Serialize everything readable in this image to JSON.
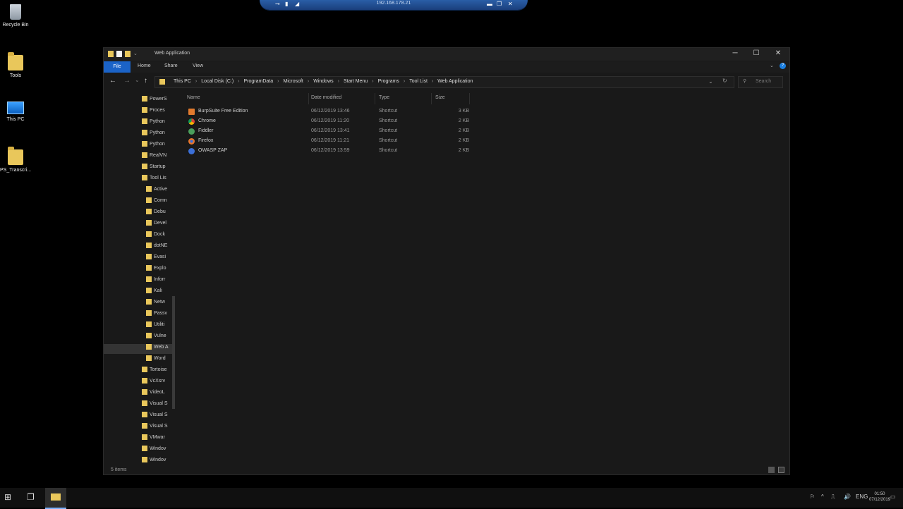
{
  "desktop": {
    "icons": [
      {
        "label": "Recycle Bin"
      },
      {
        "label": "Tools"
      },
      {
        "label": "This PC"
      },
      {
        "label": "PS_Transcri..."
      }
    ]
  },
  "rdp": {
    "ip": "192.168.178.21",
    "pin": "⊸",
    "minimize": "▬",
    "restore": "❐",
    "close": "✕"
  },
  "window": {
    "title": "Web Application",
    "controls": {
      "minimize": "─",
      "maximize": "☐",
      "close": "✕"
    },
    "ribbon_tabs": [
      "File",
      "Home",
      "Share",
      "View"
    ],
    "nav_buttons": {
      "back": "←",
      "forward": "→",
      "recent": "⌄",
      "up": "↑"
    },
    "breadcrumb": [
      "This PC",
      "Local Disk (C:)",
      "ProgramData",
      "Microsoft",
      "Windows",
      "Start Menu",
      "Programs",
      "Tool List",
      "Web Application"
    ],
    "search_placeholder": "Search",
    "refresh": "↻",
    "columns": [
      "Name",
      "Date modified",
      "Type",
      "Size"
    ],
    "files": [
      {
        "name": "BurpSuite Free Edition",
        "date": "06/12/2019 13:46",
        "type": "Shortcut",
        "size": "3 KB",
        "color": "#e07a2e"
      },
      {
        "name": "Chrome",
        "date": "06/12/2019 11:20",
        "type": "Shortcut",
        "size": "2 KB",
        "color": "#3fa34d"
      },
      {
        "name": "Fiddler",
        "date": "06/12/2019 13:41",
        "type": "Shortcut",
        "size": "2 KB",
        "color": "#4a9e5c"
      },
      {
        "name": "Firefox",
        "date": "06/12/2019 11:21",
        "type": "Shortcut",
        "size": "2 KB",
        "color": "#e8752a"
      },
      {
        "name": "OWASP ZAP",
        "date": "06/12/2019 13:59",
        "type": "Shortcut",
        "size": "2 KB",
        "color": "#3b6fd8"
      }
    ],
    "nav_tree": [
      {
        "label": "PowerS",
        "indent": 0
      },
      {
        "label": "Proces",
        "indent": 0
      },
      {
        "label": "Python",
        "indent": 0
      },
      {
        "label": "Python",
        "indent": 0
      },
      {
        "label": "Python",
        "indent": 0
      },
      {
        "label": "RealVN",
        "indent": 0
      },
      {
        "label": "Startup",
        "indent": 0
      },
      {
        "label": "Tool Lis",
        "indent": 0
      },
      {
        "label": "Active",
        "indent": 1
      },
      {
        "label": "Comn",
        "indent": 1
      },
      {
        "label": "Debu",
        "indent": 1
      },
      {
        "label": "Devel",
        "indent": 1
      },
      {
        "label": "Dock",
        "indent": 1
      },
      {
        "label": "dotNE",
        "indent": 1
      },
      {
        "label": "Evasi",
        "indent": 1
      },
      {
        "label": "Explo",
        "indent": 1
      },
      {
        "label": "Inforr",
        "indent": 1
      },
      {
        "label": "Kali",
        "indent": 1
      },
      {
        "label": "Netw",
        "indent": 1
      },
      {
        "label": "Passv",
        "indent": 1
      },
      {
        "label": "Utiliti",
        "indent": 1
      },
      {
        "label": "Vulne",
        "indent": 1
      },
      {
        "label": "Web A",
        "indent": 1,
        "selected": true
      },
      {
        "label": "Word",
        "indent": 1
      },
      {
        "label": "Tortoise",
        "indent": 0
      },
      {
        "label": "VcXsrv",
        "indent": 0
      },
      {
        "label": "VideoL",
        "indent": 0
      },
      {
        "label": "Visual S",
        "indent": 0
      },
      {
        "label": "Visual S",
        "indent": 0
      },
      {
        "label": "Visual S",
        "indent": 0
      },
      {
        "label": "VMwar",
        "indent": 0
      },
      {
        "label": "Windov",
        "indent": 0
      },
      {
        "label": "Windov",
        "indent": 0
      }
    ],
    "status": "5 items"
  },
  "taskbar": {
    "start_icon": "⊞",
    "taskview_icon": "❐",
    "explorer_icon": "▬",
    "tray": {
      "lang": "ENG",
      "network": "⎍",
      "volume": "🔊",
      "notify": "▭"
    },
    "time": "01:50",
    "date": "07/12/2019"
  }
}
